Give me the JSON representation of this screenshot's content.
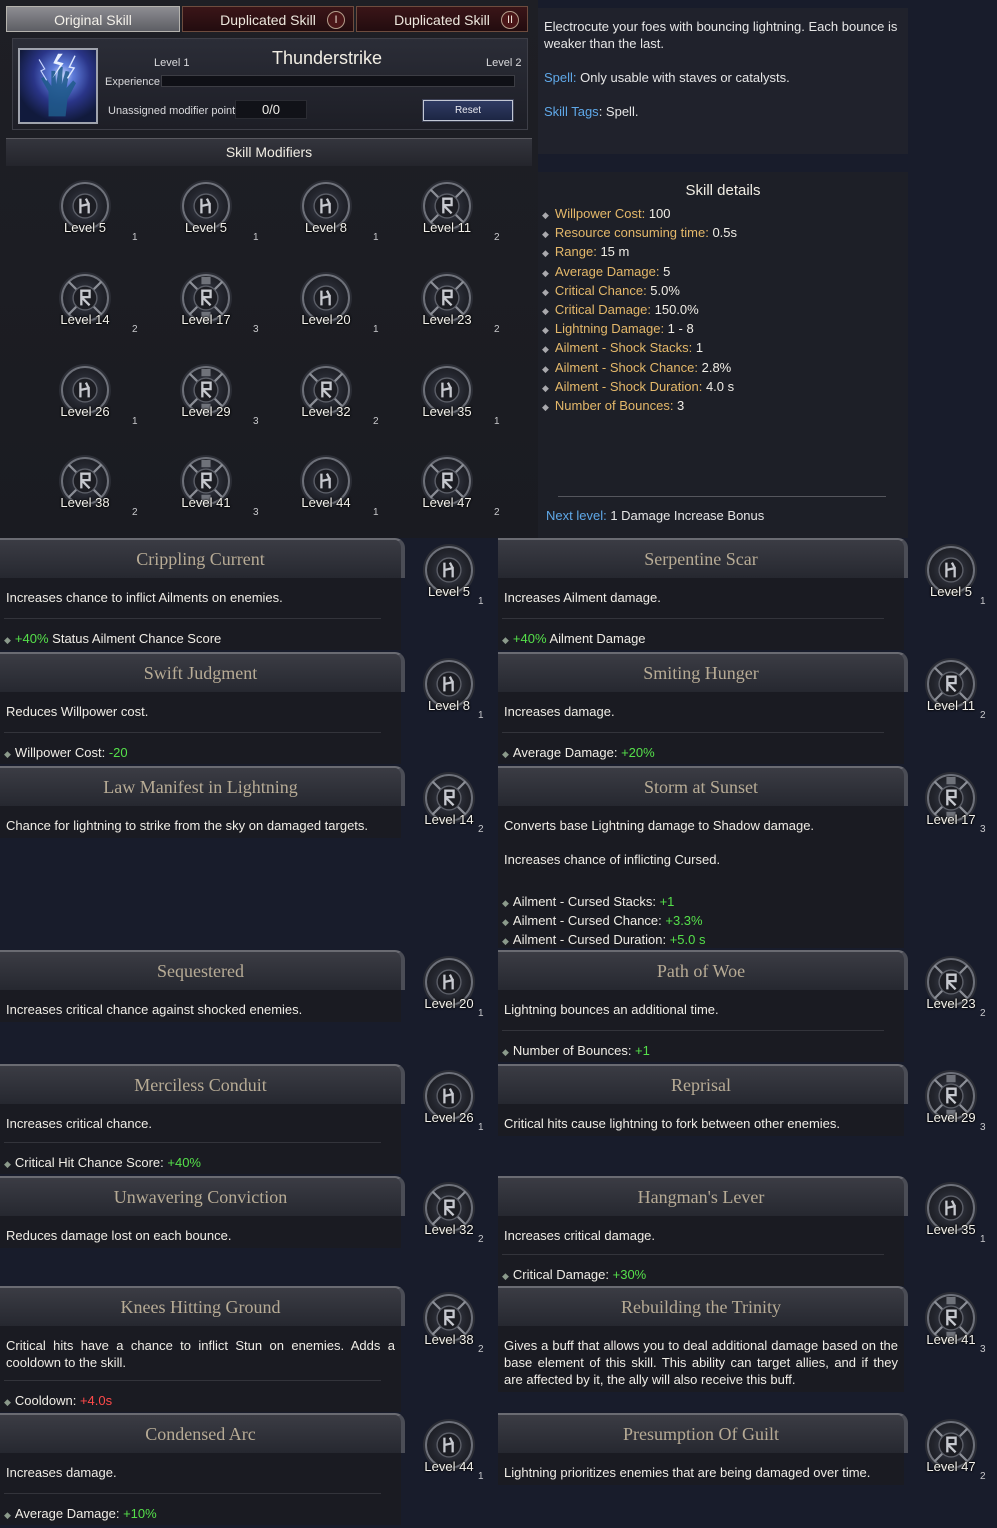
{
  "tabs": {
    "original": "Original Skill",
    "dup1": "Duplicated Skill",
    "dup1_badge": "I",
    "dup2": "Duplicated Skill",
    "dup2_badge": "II"
  },
  "skill": {
    "name": "Thunderstrike",
    "level_current": "Level 1",
    "level_next": "Level 2",
    "experience_label": "Experience",
    "experience_progress": 0,
    "unassigned_label": "Unassigned modifier points",
    "unassigned_value": "0/0",
    "reset_label": "Reset",
    "icon": "lightning-hand-icon"
  },
  "modifiers_title": "Skill Modifiers",
  "modifier_grid": [
    {
      "level": "Level 5",
      "tier": "1"
    },
    {
      "level": "Level 5",
      "tier": "1"
    },
    {
      "level": "Level 8",
      "tier": "1"
    },
    {
      "level": "Level 11",
      "tier": "2"
    },
    {
      "level": "Level 14",
      "tier": "2"
    },
    {
      "level": "Level 17",
      "tier": "3"
    },
    {
      "level": "Level 20",
      "tier": "1"
    },
    {
      "level": "Level 23",
      "tier": "2"
    },
    {
      "level": "Level 26",
      "tier": "1"
    },
    {
      "level": "Level 29",
      "tier": "3"
    },
    {
      "level": "Level 32",
      "tier": "2"
    },
    {
      "level": "Level 35",
      "tier": "1"
    },
    {
      "level": "Level 38",
      "tier": "2"
    },
    {
      "level": "Level 41",
      "tier": "3"
    },
    {
      "level": "Level 44",
      "tier": "1"
    },
    {
      "level": "Level 47",
      "tier": "2"
    }
  ],
  "description": {
    "text": "Electrocute your foes with bouncing lightning. Each bounce is weaker than the last.",
    "spell_label": "Spell:",
    "spell_text": "Only usable with staves or catalysts.",
    "tags_label": "Skill Tags",
    "tags_value": "Spell."
  },
  "details": {
    "title": "Skill details",
    "rows": [
      {
        "label": "Willpower Cost:",
        "value": "100"
      },
      {
        "label": "Resource consuming time:",
        "value": "0.5s"
      },
      {
        "label": "Range:",
        "value": "15 m"
      },
      {
        "label": "Average Damage:",
        "value": "5"
      },
      {
        "label": "Critical Chance:",
        "value": "5.0%"
      },
      {
        "label": "Critical Damage:",
        "value": "150.0%"
      },
      {
        "label": "Lightning Damage:",
        "value": "1 - 8"
      },
      {
        "label": "Ailment - Shock Stacks:",
        "value": "1"
      },
      {
        "label": "Ailment - Shock Chance:",
        "value": "2.8%"
      },
      {
        "label": "Ailment - Shock Duration:",
        "value": "4.0 s"
      },
      {
        "label": "Number of Bounces:",
        "value": "3"
      }
    ],
    "next_level_label": "Next level:",
    "next_level_value": "1 Damage Increase Bonus"
  },
  "cards": [
    {
      "title": "Crippling Current",
      "desc": "Increases chance to inflict Ailments on enemies.",
      "stat_prefix": "",
      "stat_value": "+40%",
      "stat_suffix": " Status Ailment Chance Score",
      "level": "Level 5",
      "tier": "1"
    },
    {
      "title": "Serpentine Scar",
      "desc": "Increases Ailment damage.",
      "stat_prefix": "",
      "stat_value": "+40%",
      "stat_suffix": " Ailment Damage",
      "level": "Level 5",
      "tier": "1"
    },
    {
      "title": "Swift Judgment",
      "desc": "Reduces Willpower cost.",
      "stat_prefix": "Willpower Cost: ",
      "stat_value": "-20",
      "stat_suffix": "",
      "level": "Level 8",
      "tier": "1"
    },
    {
      "title": "Smiting Hunger",
      "desc": "Increases damage.",
      "stat_prefix": "Average Damage: ",
      "stat_value": "+20%",
      "stat_suffix": "",
      "level": "Level 11",
      "tier": "2"
    },
    {
      "title": "Law Manifest in Lightning",
      "desc": "Chance for lightning to strike from the sky on damaged targets.",
      "level": "Level 14",
      "tier": "2"
    },
    {
      "title": "Storm at Sunset",
      "desc": "Converts base Lightning damage to Shadow damage.",
      "desc2": "Increases chance of inflicting Cursed.",
      "stats": [
        {
          "prefix": "Ailment - Cursed Stacks: ",
          "value": "+1"
        },
        {
          "prefix": "Ailment - Cursed Chance: ",
          "value": "+3.3%"
        },
        {
          "prefix": "Ailment - Cursed Duration: ",
          "value": "+5.0 s"
        }
      ],
      "level": "Level 17",
      "tier": "3"
    },
    {
      "title": "Sequestered",
      "desc": "Increases critical chance against shocked enemies.",
      "level": "Level 20",
      "tier": "1"
    },
    {
      "title": "Path of Woe",
      "desc": "Lightning bounces an additional time.",
      "stat_prefix": "Number of Bounces: ",
      "stat_value": "+1",
      "stat_suffix": "",
      "level": "Level 23",
      "tier": "2"
    },
    {
      "title": "Merciless Conduit",
      "desc": "Increases critical chance.",
      "stat_prefix": "Critical Hit Chance Score: ",
      "stat_value": "+40%",
      "stat_suffix": "",
      "level": "Level 26",
      "tier": "1"
    },
    {
      "title": "Reprisal",
      "desc": "Critical hits cause lightning to fork between other enemies.",
      "level": "Level 29",
      "tier": "3"
    },
    {
      "title": "Unwavering Conviction",
      "desc": "Reduces damage lost on each bounce.",
      "level": "Level 32",
      "tier": "2"
    },
    {
      "title": "Hangman's Lever",
      "desc": "Increases critical damage.",
      "stat_prefix": "Critical Damage: ",
      "stat_value": "+30%",
      "stat_suffix": "",
      "level": "Level 35",
      "tier": "1"
    },
    {
      "title": "Knees Hitting Ground",
      "desc": "Critical hits have a chance to inflict Stun on enemies. Adds a cooldown to the skill.",
      "stat_prefix": "Cooldown: ",
      "stat_value": "+4.0s",
      "stat_suffix": "",
      "level": "Level 38",
      "tier": "2"
    },
    {
      "title": "Rebuilding the Trinity",
      "desc": "Gives a buff that allows you to deal additional damage based on the base element of this skill. This ability can target allies, and if they are affected by it, the ally will also receive this buff.",
      "level": "Level 41",
      "tier": "3"
    },
    {
      "title": "Condensed Arc",
      "desc": "Increases damage.",
      "stat_prefix": "Average Damage: ",
      "stat_value": "+10%",
      "stat_suffix": "",
      "level": "Level 44",
      "tier": "1"
    },
    {
      "title": "Presumption Of Guilt",
      "desc": "Lightning prioritizes enemies that are being damaged over time.",
      "level": "Level 47",
      "tier": "2"
    }
  ],
  "colors": {
    "background": "#181c2b",
    "positive": "#55e04a",
    "negative": "#ff4a4a",
    "label_gold": "#e4b86a",
    "label_blue": "#5fa8e8"
  }
}
